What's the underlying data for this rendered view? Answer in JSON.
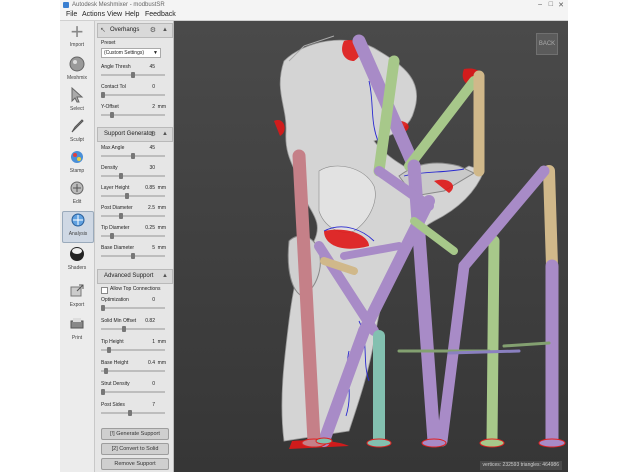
{
  "window": {
    "title": "Autodesk Meshmixer - modbustSR",
    "controls": [
      "–",
      "□",
      "✕"
    ]
  },
  "menu": [
    "File",
    "Actions",
    "View",
    "Help",
    "Feedback"
  ],
  "toolbar": [
    {
      "label": "Import",
      "icon": "plus-icon"
    },
    {
      "label": "Meshmix",
      "icon": "sphere-icon"
    },
    {
      "label": "Select",
      "icon": "arrow-icon"
    },
    {
      "label": "Sculpt",
      "icon": "brush-icon"
    },
    {
      "label": "Stamp",
      "icon": "stamp-icon"
    },
    {
      "label": "Edit",
      "icon": "edit-icon"
    },
    {
      "label": "Analysis",
      "icon": "analysis-icon"
    },
    {
      "label": "Shaders",
      "icon": "shader-ball-icon"
    },
    {
      "label": "Export",
      "icon": "export-icon"
    },
    {
      "label": "Print",
      "icon": "printer-icon"
    }
  ],
  "overhangs": {
    "title": "Overhangs",
    "preset_label": "Preset",
    "preset_value": "(Custom Settings)",
    "fields": [
      {
        "label": "Angle Thresh",
        "value": "45",
        "unit": "",
        "level": 0.5
      },
      {
        "label": "Contact Tol",
        "value": "0",
        "unit": "",
        "level": 0.0
      },
      {
        "label": "Y-Offset",
        "value": "2",
        "unit": "mm",
        "level": 0.15
      }
    ]
  },
  "support_generator": {
    "title": "Support Generator",
    "fields": [
      {
        "label": "Max Angle",
        "value": "45",
        "unit": "",
        "level": 0.5
      },
      {
        "label": "Density",
        "value": "30",
        "unit": "",
        "level": 0.3
      },
      {
        "label": "Layer Height",
        "value": "0.85",
        "unit": "mm",
        "level": 0.4
      },
      {
        "label": "Post Diameter",
        "value": "2.5",
        "unit": "mm",
        "level": 0.3
      },
      {
        "label": "Tip Diameter",
        "value": "0.25",
        "unit": "mm",
        "level": 0.15
      },
      {
        "label": "Base Diameter",
        "value": "5",
        "unit": "mm",
        "level": 0.5
      }
    ]
  },
  "advanced_support": {
    "title": "Advanced Support",
    "allow_top_connections": "Allow Top Connections",
    "fields": [
      {
        "label": "Optimization",
        "value": "0",
        "unit": "",
        "level": 0.0
      },
      {
        "label": "Solid Min Offset",
        "value": "0.82",
        "unit": "",
        "level": 0.35
      },
      {
        "label": "Tip Height",
        "value": "1",
        "unit": "mm",
        "level": 0.1
      },
      {
        "label": "Base Height",
        "value": "0.4",
        "unit": "mm",
        "level": 0.05
      },
      {
        "label": "Strut Density",
        "value": "0",
        "unit": "",
        "level": 0.0
      },
      {
        "label": "Post Sides",
        "value": "7",
        "unit": "",
        "level": 0.45
      }
    ]
  },
  "actions": {
    "generate": "[!] Generate Support",
    "convert": "[2] Convert to Solid",
    "remove": "Remove Support"
  },
  "viewport": {
    "view_cube": "BACK",
    "status": "vertices: 232593  triangles: 464986"
  }
}
